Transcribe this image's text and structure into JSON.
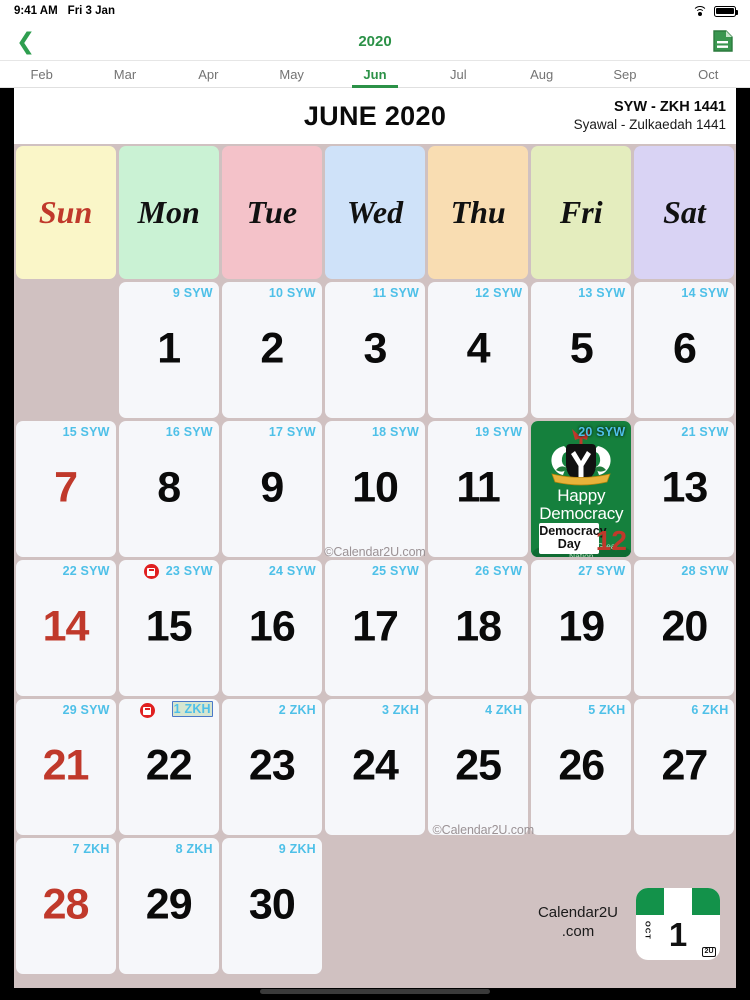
{
  "status_bar": {
    "time": "9:41 AM",
    "date": "Fri 3 Jan",
    "wifi_icon": "wifi-icon",
    "battery_icon": "battery-icon"
  },
  "nav": {
    "back_icon": "chevron-left-icon",
    "year": "2020",
    "note_icon": "document-icon"
  },
  "month_tabs": {
    "items": [
      {
        "label": "Feb",
        "active": false
      },
      {
        "label": "Mar",
        "active": false
      },
      {
        "label": "Apr",
        "active": false
      },
      {
        "label": "May",
        "active": false
      },
      {
        "label": "Jun",
        "active": true
      },
      {
        "label": "Jul",
        "active": false
      },
      {
        "label": "Aug",
        "active": false
      },
      {
        "label": "Sep",
        "active": false
      },
      {
        "label": "Oct",
        "active": false
      }
    ]
  },
  "calendar": {
    "month_title": "JUNE 2020",
    "hijri_short": "SYW - ZKH 1441",
    "hijri_long": "Syawal - Zulkaedah 1441",
    "weekday_headers": [
      {
        "label": "Sun",
        "bg": "#faf6c8"
      },
      {
        "label": "Mon",
        "bg": "#caf2d4"
      },
      {
        "label": "Tue",
        "bg": "#f4c2c9"
      },
      {
        "label": "Wed",
        "bg": "#cfe2f9"
      },
      {
        "label": "Thu",
        "bg": "#f9ddb2"
      },
      {
        "label": "Fri",
        "bg": "#e4edbe"
      },
      {
        "label": "Sat",
        "bg": "#d9d3f4"
      }
    ],
    "watermark": "©Calendar2U.com",
    "weeks": [
      [
        {
          "empty": true
        },
        {
          "day": "1",
          "hijri": "9 SYW"
        },
        {
          "day": "2",
          "hijri": "10 SYW"
        },
        {
          "day": "3",
          "hijri": "11 SYW"
        },
        {
          "day": "4",
          "hijri": "12 SYW"
        },
        {
          "day": "5",
          "hijri": "13 SYW"
        },
        {
          "day": "6",
          "hijri": "14 SYW"
        }
      ],
      [
        {
          "day": "7",
          "hijri": "15 SYW",
          "sunday": true
        },
        {
          "day": "8",
          "hijri": "16 SYW"
        },
        {
          "day": "9",
          "hijri": "17 SYW"
        },
        {
          "day": "10",
          "hijri": "18 SYW"
        },
        {
          "day": "11",
          "hijri": "19 SYW"
        },
        {
          "day": "12",
          "hijri": "20 SYW",
          "holiday": {
            "greeting_line1": "Happy",
            "greeting_line2": "Democracy Day",
            "motto": "Good People  Great Nation",
            "badge_line1": "Democracy",
            "badge_line2": "Day",
            "number": "12"
          }
        },
        {
          "day": "13",
          "hijri": "21 SYW"
        }
      ],
      [
        {
          "day": "14",
          "hijri": "22 SYW",
          "sunday": true
        },
        {
          "day": "15",
          "hijri": "23 SYW",
          "event_icon": "event-marker-icon"
        },
        {
          "day": "16",
          "hijri": "24 SYW"
        },
        {
          "day": "17",
          "hijri": "25 SYW"
        },
        {
          "day": "18",
          "hijri": "26 SYW"
        },
        {
          "day": "19",
          "hijri": "27 SYW"
        },
        {
          "day": "20",
          "hijri": "28 SYW"
        }
      ],
      [
        {
          "day": "21",
          "hijri": "29 SYW",
          "sunday": true
        },
        {
          "day": "22",
          "hijri": "1 ZKH",
          "event_icon": "event-marker-icon",
          "selected": true
        },
        {
          "day": "23",
          "hijri": "2 ZKH"
        },
        {
          "day": "24",
          "hijri": "3 ZKH"
        },
        {
          "day": "25",
          "hijri": "4 ZKH"
        },
        {
          "day": "26",
          "hijri": "5 ZKH"
        },
        {
          "day": "27",
          "hijri": "6 ZKH"
        }
      ],
      [
        {
          "day": "28",
          "hijri": "7 ZKH",
          "sunday": true
        },
        {
          "day": "29",
          "hijri": "8 ZKH"
        },
        {
          "day": "30",
          "hijri": "9 ZKH"
        },
        {
          "empty": true
        },
        {
          "empty": true
        },
        {
          "empty": true
        },
        {
          "empty": true
        }
      ]
    ]
  },
  "footer": {
    "brand_line1": "Calendar2U",
    "brand_line2": ".com",
    "logo": {
      "month": "OCT",
      "day": "1",
      "tag": "2U",
      "flag_icon": "nigeria-flag-icon"
    }
  },
  "colors": {
    "accent_green": "#2b9147",
    "sunday_red": "#c0392b",
    "hijri_cyan": "#4ec0e8",
    "page_bg": "#d0c1c1"
  }
}
